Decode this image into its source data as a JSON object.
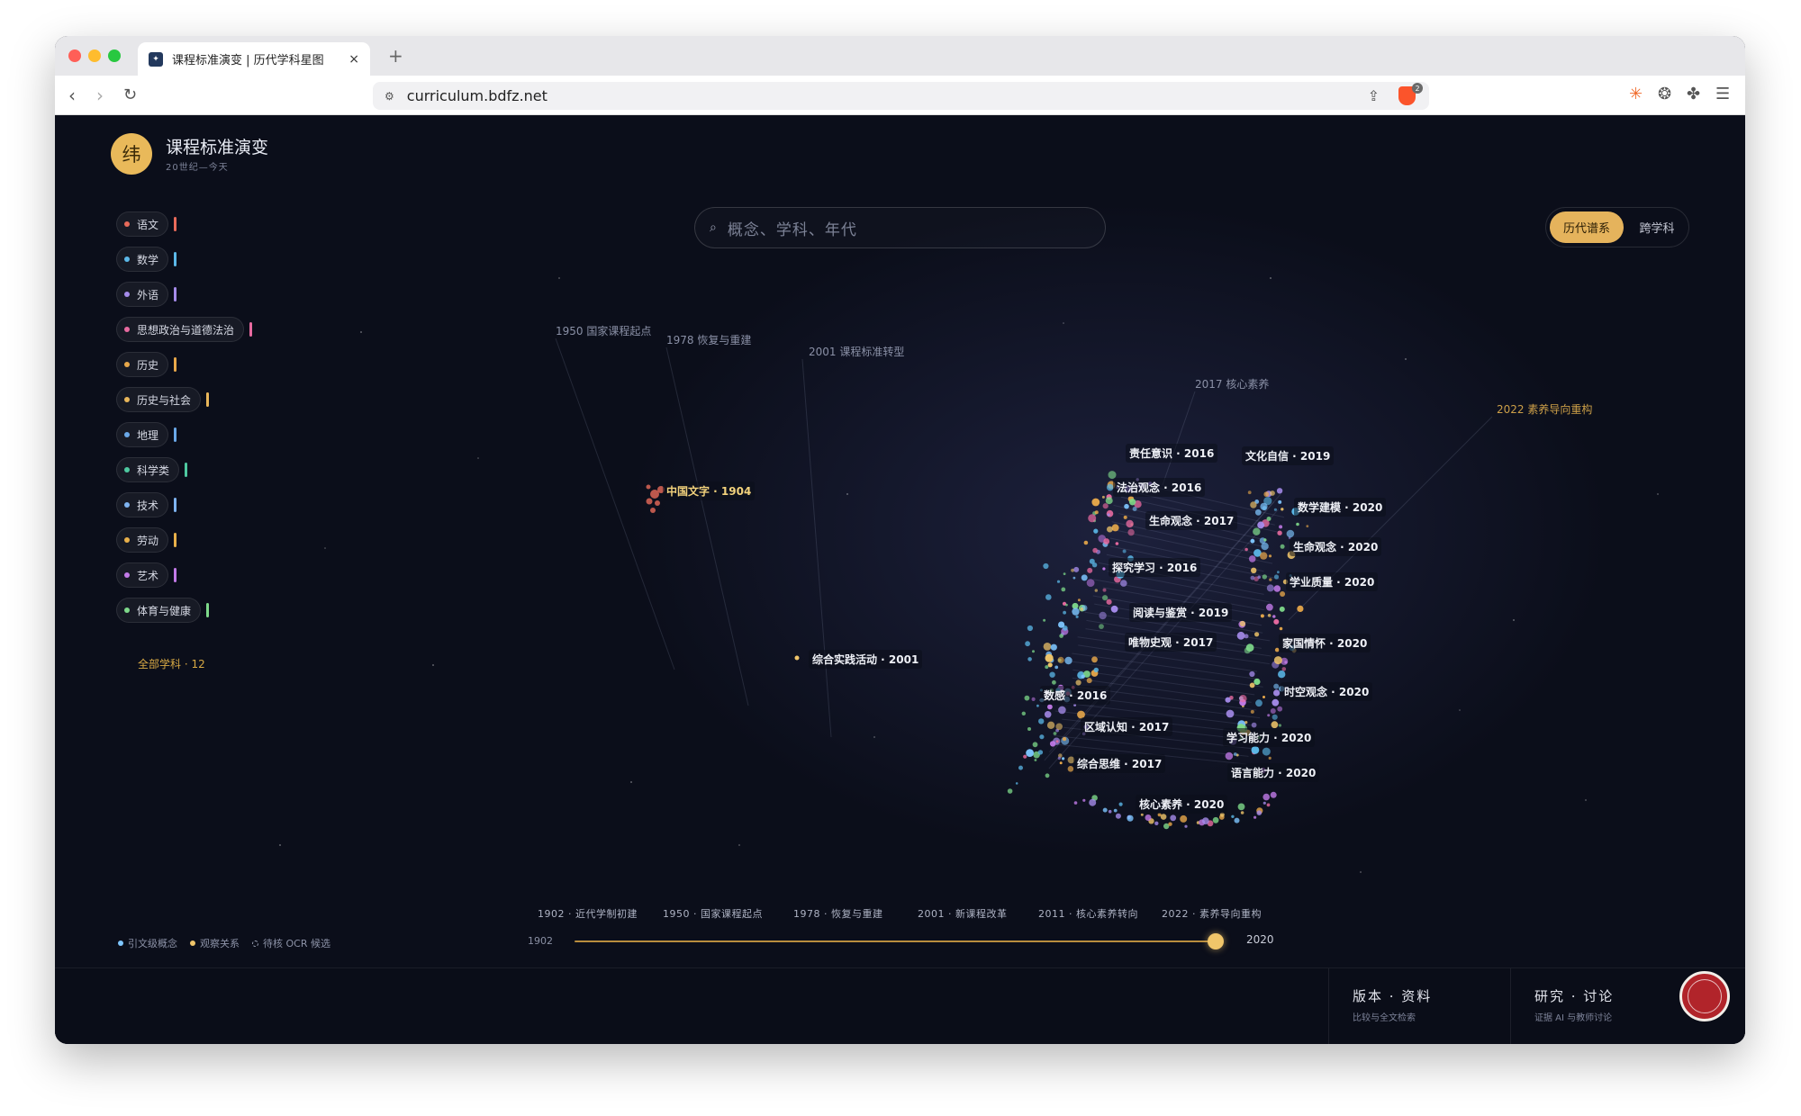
{
  "browser": {
    "tab_title": "课程标准演变 | 历代学科星图",
    "url": "curriculum.bdfz.net",
    "new_tab": "+",
    "close_tab": "×",
    "shield_count": "2"
  },
  "header": {
    "logo_char": "纬",
    "title": "课程标准演变",
    "subtitle": "20世纪—今天"
  },
  "search": {
    "placeholder": "概念、学科、年代"
  },
  "view_toggle": {
    "active": "历代谱系",
    "other": "跨学科"
  },
  "subjects": [
    {
      "label": "语文",
      "color": "#e86a5a"
    },
    {
      "label": "数学",
      "color": "#5bb8e8"
    },
    {
      "label": "外语",
      "color": "#a58bea"
    },
    {
      "label": "思想政治与道德法治",
      "color": "#e86aa0"
    },
    {
      "label": "历史",
      "color": "#e8a84a"
    },
    {
      "label": "历史与社会",
      "color": "#e8b65a"
    },
    {
      "label": "地理",
      "color": "#6aa8e8"
    },
    {
      "label": "科学类",
      "color": "#4ec9a0"
    },
    {
      "label": "技术",
      "color": "#7eb3f0"
    },
    {
      "label": "劳动",
      "color": "#e8b04a"
    },
    {
      "label": "艺术",
      "color": "#c27ae8"
    },
    {
      "label": "体育与健康",
      "color": "#7ed98a"
    }
  ],
  "subjects_total": "全部学科 · 12",
  "eras": [
    {
      "label": "1950 国家课程起点"
    },
    {
      "label": "1978 恢复与重建"
    },
    {
      "label": "2001 课程标准转型"
    },
    {
      "label": "2017 核心素养"
    },
    {
      "label": "2022 素养导向重构"
    }
  ],
  "nodes": [
    {
      "label": "中国文字 · 1904"
    },
    {
      "label": "综合实践活动 · 2001"
    },
    {
      "label": "责任意识 · 2016"
    },
    {
      "label": "文化自信 · 2019"
    },
    {
      "label": "法治观念 · 2016"
    },
    {
      "label": "数学建模 · 2020"
    },
    {
      "label": "生命观念 · 2017"
    },
    {
      "label": "生命观念 · 2020"
    },
    {
      "label": "探究学习 · 2016"
    },
    {
      "label": "学业质量 · 2020"
    },
    {
      "label": "阅读与鉴赏 · 2019"
    },
    {
      "label": "唯物史观 · 2017"
    },
    {
      "label": "家国情怀 · 2020"
    },
    {
      "label": "时空观念 · 2020"
    },
    {
      "label": "数感 · 2016"
    },
    {
      "label": "区域认知 · 2017"
    },
    {
      "label": "学习能力 · 2020"
    },
    {
      "label": "综合思维 · 2017"
    },
    {
      "label": "语言能力 · 2020"
    },
    {
      "label": "核心素养 · 2020"
    }
  ],
  "legend": {
    "concept": "引文级概念",
    "relation": "观察关系",
    "ocr": "待核 OCR 候选"
  },
  "timeline": {
    "eras": [
      "1902 · 近代学制初建",
      "1950 · 国家课程起点",
      "1978 · 恢复与重建",
      "2001 · 新课程改革",
      "2011 · 核心素养转向",
      "2022 · 素养导向重构"
    ],
    "start": "1902",
    "end": "2020",
    "current": 2020
  },
  "footer": {
    "versions_title": "版本 · 资料",
    "versions_sub": "比较与全文检索",
    "research_title": "研究 · 讨论",
    "research_sub": "证据 AI 与教师讨论"
  },
  "colors": {
    "accent": "#e5b35c",
    "background": "#0b0e1a"
  }
}
